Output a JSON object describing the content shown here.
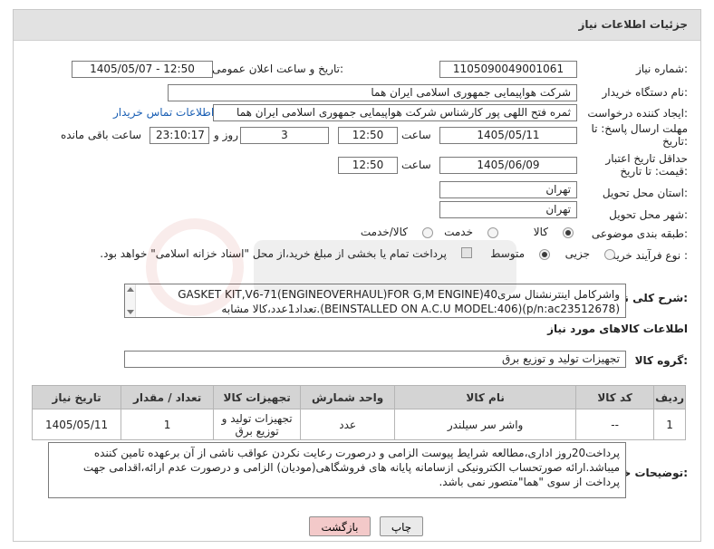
{
  "header": {
    "title": "جزئیات اطلاعات نیاز"
  },
  "labels": {
    "need_number": "شماره نیاز:",
    "announce_datetime": "تاریخ و ساعت اعلان عمومی:",
    "buyer_org": "نام دستگاه خریدار:",
    "requester": "ایجاد کننده درخواست:",
    "reply_deadline": "مهلت ارسال پاسخ: تا تاریخ:",
    "price_validity": "حداقل تاریخ اعتبار قیمت: تا تاریخ:",
    "time": "ساعت",
    "day_and": "روز و",
    "remaining": "ساعت باقی مانده",
    "delivery_province": "استان محل تحویل:",
    "delivery_city": "شهر محل تحویل:",
    "category": "طبقه بندی موضوعی:",
    "process_type": "نوع فرآیند خرید :",
    "general_desc": "شرح کلی نیاز:",
    "goods_info": "اطلاعات کالاهای مورد نیاز",
    "goods_group": "گروه کالا:",
    "buyer_notes": "توضیحات خریدار:"
  },
  "values": {
    "need_number": "1105090049001061",
    "announce_datetime": "1405/05/07 - 12:50",
    "buyer_org": "شرکت هواپیمایی جمهوری اسلامی ایران هما",
    "requester": "ثمره فتح اللهی پور کارشناس شرکت هواپیمایی جمهوری اسلامی ایران هما",
    "contact_link": "اطلاعات تماس خریدار",
    "reply_date": "1405/05/11",
    "reply_time": "12:50",
    "reply_days": "3",
    "reply_remaining": "23:10:17",
    "price_date": "1405/06/09",
    "price_time": "12:50",
    "province": "تهران",
    "city": "تهران"
  },
  "category_options": {
    "goods": "کالا",
    "service": "خدمت",
    "goods_service": "کالا/خدمت",
    "selected": "goods"
  },
  "process_options": {
    "partial": "جزیی",
    "medium": "متوسط",
    "selected": "medium",
    "treasury_note": "پرداخت تمام یا بخشی از مبلغ خرید،از محل \"اسناد خزانه اسلامی\" خواهد بود."
  },
  "description": {
    "line1": "واشرکامل اینترنشنال سریGASKET KIT,V6-71(ENGINEOVERHAUL)FOR G,M ENGINE)40",
    "line2": "(p/n:ac23512678)(BEINSTALLED ON A.C.U MODEL:406).تعداد1عدد،کالا مشابه"
  },
  "goods_group": "تجهیزات تولید و توزیع برق",
  "table": {
    "headers": [
      "ردیف",
      "کد کالا",
      "نام کالا",
      "واحد شمارش",
      "تجهیزات کالا",
      "تعداد / مقدار",
      "تاریخ نیاز"
    ],
    "rows": [
      [
        "1",
        "--",
        "واشر سر سیلندر",
        "عدد",
        "تجهیزات تولید و توزیع برق",
        "1",
        "1405/05/11"
      ]
    ]
  },
  "buyer_notes": "پرداخت20روز اداری،مطالعه شرایط پیوست الزامی و درصورت رعایت نکردن عواقب ناشی از آن برعهده تامین کننده میباشد.ارائه صورتحساب الکترونیکی ازسامانه پایانه های فروشگاهی(مودیان) الزامی و درصورت عدم ارائه،اقدامی جهت پرداخت از سوی \"هما\"متصور نمی باشد.",
  "buttons": {
    "print": "چاپ",
    "back": "بازگشت"
  },
  "colors": {
    "header_bg": "#e2e2e2",
    "link": "#1a5fb4",
    "back_button": "#f3c9c9"
  }
}
